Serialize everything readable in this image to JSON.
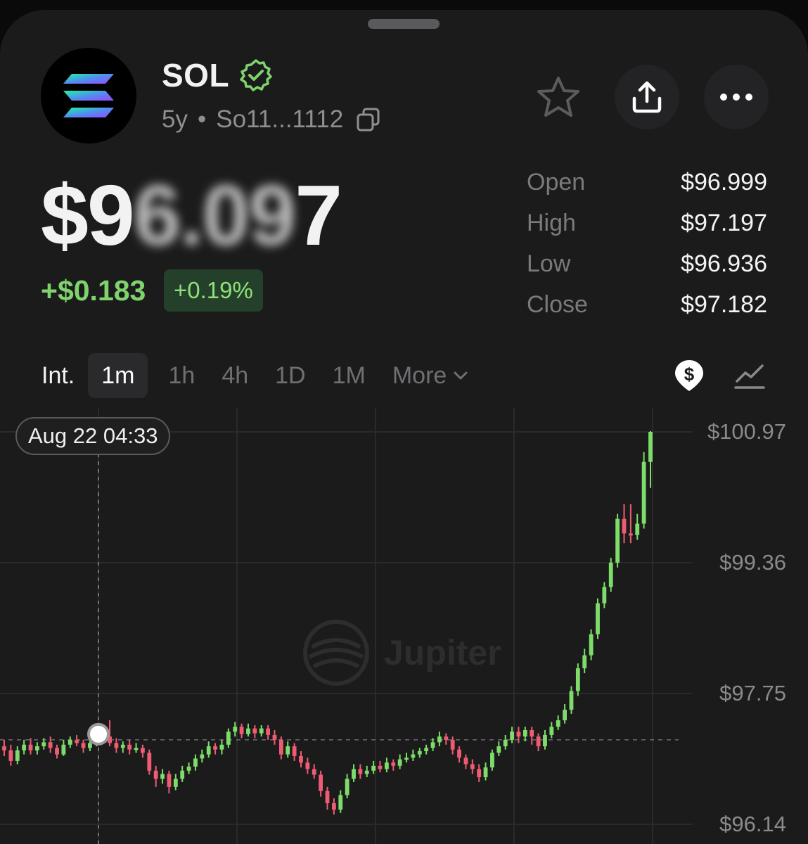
{
  "token": {
    "symbol": "SOL",
    "age": "5y",
    "separator": "•",
    "address": "So11...1112"
  },
  "icons": {
    "logo": "solana-logo-icon",
    "verified": "verified-badge-icon",
    "copy": "copy-icon",
    "favorite": "star-icon",
    "share": "share-icon",
    "more": "more-icon",
    "currency_toggle": "dollar-icon",
    "chart_type": "line-chart-icon",
    "more_chevron": "chevron-down-icon",
    "watermark": "jupiter-logo-icon"
  },
  "price": {
    "symbol": "$",
    "digit_1": "9",
    "digits_blurred_front": "6.0",
    "digits_blurred_mid": "9",
    "digit_last": "7",
    "change_abs": "+$0.183",
    "change_pct": "+0.19%"
  },
  "ohlc": [
    {
      "label": "Open",
      "value": "$96.999"
    },
    {
      "label": "High",
      "value": "$97.197"
    },
    {
      "label": "Low",
      "value": "$96.936"
    },
    {
      "label": "Close",
      "value": "$97.182"
    }
  ],
  "intervals": {
    "prefix": "Int.",
    "options": [
      "1m",
      "1h",
      "4h",
      "1D",
      "1M"
    ],
    "active": "1m",
    "more": "More"
  },
  "crosshair": {
    "time": "Aug 22 04:33"
  },
  "watermark": "Jupiter",
  "colors": {
    "up": "#7ddc6a",
    "down": "#ef5b73",
    "positive_text": "#7fd36d",
    "verified": "#7fd36d"
  },
  "chart_data": {
    "type": "candlestick",
    "y_ticks": [
      "$100.97",
      "$99.36",
      "$97.75",
      "$96.14"
    ],
    "y_tick_values": [
      100.97,
      99.36,
      97.75,
      96.14
    ],
    "ylim": [
      95.96,
      101.2
    ],
    "reference_price": 97.18,
    "grid": true,
    "candles": [
      [
        97.1,
        97.05,
        97.18,
        96.98
      ],
      [
        97.05,
        96.92,
        97.12,
        96.86
      ],
      [
        96.92,
        97.05,
        97.1,
        96.88
      ],
      [
        97.05,
        97.12,
        97.18,
        97.0
      ],
      [
        97.12,
        97.05,
        97.2,
        97.0
      ],
      [
        97.05,
        97.1,
        97.15,
        97.0
      ],
      [
        97.1,
        97.15,
        97.2,
        97.06
      ],
      [
        97.15,
        97.08,
        97.22,
        97.02
      ],
      [
        97.08,
        97.0,
        97.12,
        96.95
      ],
      [
        97.0,
        97.12,
        97.18,
        96.98
      ],
      [
        97.12,
        97.18,
        97.22,
        97.08
      ],
      [
        97.18,
        97.14,
        97.24,
        97.1
      ],
      [
        97.14,
        97.08,
        97.18,
        97.02
      ],
      [
        97.08,
        97.14,
        97.18,
        97.04
      ],
      [
        97.14,
        97.2,
        97.26,
        97.1
      ],
      [
        97.2,
        97.22,
        97.28,
        97.15
      ],
      [
        97.22,
        97.14,
        97.42,
        97.1
      ],
      [
        97.14,
        97.08,
        97.2,
        97.02
      ],
      [
        97.08,
        97.12,
        97.16,
        97.02
      ],
      [
        97.12,
        97.06,
        97.18,
        97.0
      ],
      [
        97.06,
        97.08,
        97.14,
        97.02
      ],
      [
        97.08,
        97.02,
        97.12,
        96.96
      ],
      [
        97.02,
        96.8,
        97.06,
        96.75
      ],
      [
        96.8,
        96.7,
        96.86,
        96.6
      ],
      [
        96.7,
        96.76,
        96.82,
        96.64
      ],
      [
        96.76,
        96.6,
        96.8,
        96.52
      ],
      [
        96.6,
        96.7,
        96.76,
        96.56
      ],
      [
        96.7,
        96.8,
        96.86,
        96.66
      ],
      [
        96.8,
        96.85,
        96.9,
        96.76
      ],
      [
        96.85,
        96.95,
        97.0,
        96.8
      ],
      [
        96.95,
        97.0,
        97.06,
        96.9
      ],
      [
        97.0,
        97.1,
        97.16,
        96.96
      ],
      [
        97.1,
        97.06,
        97.14,
        97.0
      ],
      [
        97.06,
        97.12,
        97.18,
        97.0
      ],
      [
        97.12,
        97.28,
        97.32,
        97.08
      ],
      [
        97.28,
        97.34,
        97.4,
        97.22
      ],
      [
        97.34,
        97.25,
        97.38,
        97.2
      ],
      [
        97.25,
        97.32,
        97.38,
        97.22
      ],
      [
        97.32,
        97.26,
        97.36,
        97.2
      ],
      [
        97.26,
        97.32,
        97.36,
        97.22
      ],
      [
        97.32,
        97.24,
        97.36,
        97.18
      ],
      [
        97.24,
        97.18,
        97.3,
        97.12
      ],
      [
        97.18,
        97.0,
        97.22,
        96.94
      ],
      [
        97.0,
        97.1,
        97.16,
        96.96
      ],
      [
        97.1,
        96.98,
        97.14,
        96.92
      ],
      [
        96.98,
        96.9,
        97.04,
        96.84
      ],
      [
        96.9,
        96.82,
        96.96,
        96.76
      ],
      [
        96.82,
        96.75,
        96.88,
        96.7
      ],
      [
        96.75,
        96.55,
        96.8,
        96.48
      ],
      [
        96.55,
        96.4,
        96.6,
        96.32
      ],
      [
        96.4,
        96.32,
        96.46,
        96.26
      ],
      [
        96.32,
        96.5,
        96.56,
        96.28
      ],
      [
        96.5,
        96.7,
        96.76,
        96.46
      ],
      [
        96.7,
        96.82,
        96.88,
        96.66
      ],
      [
        96.82,
        96.76,
        96.88,
        96.7
      ],
      [
        96.76,
        96.8,
        96.86,
        96.72
      ],
      [
        96.8,
        96.86,
        96.92,
        96.76
      ],
      [
        96.86,
        96.82,
        96.92,
        96.78
      ],
      [
        96.82,
        96.9,
        96.96,
        96.78
      ],
      [
        96.9,
        96.86,
        96.94,
        96.8
      ],
      [
        96.86,
        96.94,
        97.0,
        96.82
      ],
      [
        96.94,
        96.96,
        97.02,
        96.9
      ],
      [
        96.96,
        97.0,
        97.06,
        96.92
      ],
      [
        97.0,
        97.04,
        97.08,
        96.96
      ],
      [
        97.04,
        97.08,
        97.12,
        97.0
      ],
      [
        97.08,
        97.15,
        97.2,
        97.04
      ],
      [
        97.15,
        97.22,
        97.28,
        97.1
      ],
      [
        97.22,
        97.18,
        97.26,
        97.12
      ],
      [
        97.18,
        97.06,
        97.22,
        97.0
      ],
      [
        97.06,
        96.96,
        97.1,
        96.9
      ],
      [
        96.96,
        96.88,
        97.0,
        96.82
      ],
      [
        96.88,
        96.82,
        96.94,
        96.76
      ],
      [
        96.82,
        96.72,
        96.88,
        96.66
      ],
      [
        96.72,
        96.84,
        96.9,
        96.68
      ],
      [
        96.84,
        97.02,
        97.06,
        96.8
      ],
      [
        97.02,
        97.1,
        97.16,
        96.98
      ],
      [
        97.1,
        97.18,
        97.24,
        97.06
      ],
      [
        97.18,
        97.28,
        97.34,
        97.14
      ],
      [
        97.28,
        97.22,
        97.34,
        97.14
      ],
      [
        97.22,
        97.3,
        97.34,
        97.16
      ],
      [
        97.3,
        97.22,
        97.34,
        97.12
      ],
      [
        97.22,
        97.1,
        97.26,
        97.04
      ],
      [
        97.1,
        97.24,
        97.3,
        97.06
      ],
      [
        97.24,
        97.34,
        97.4,
        97.2
      ],
      [
        97.34,
        97.42,
        97.48,
        97.3
      ],
      [
        97.42,
        97.55,
        97.62,
        97.38
      ],
      [
        97.55,
        97.78,
        97.84,
        97.5
      ],
      [
        97.78,
        98.06,
        98.12,
        97.72
      ],
      [
        98.06,
        98.22,
        98.3,
        98.0
      ],
      [
        98.22,
        98.48,
        98.54,
        98.16
      ],
      [
        98.48,
        98.86,
        98.92,
        98.42
      ],
      [
        98.86,
        99.06,
        99.12,
        98.8
      ],
      [
        99.06,
        99.36,
        99.42,
        99.0
      ],
      [
        99.36,
        99.9,
        99.96,
        99.3
      ],
      [
        99.9,
        99.72,
        100.08,
        99.6
      ],
      [
        99.72,
        99.7,
        100.08,
        99.6
      ],
      [
        99.7,
        99.84,
        99.96,
        99.64
      ],
      [
        99.84,
        100.6,
        100.72,
        99.78
      ],
      [
        100.6,
        100.97,
        100.98,
        100.28
      ]
    ]
  }
}
